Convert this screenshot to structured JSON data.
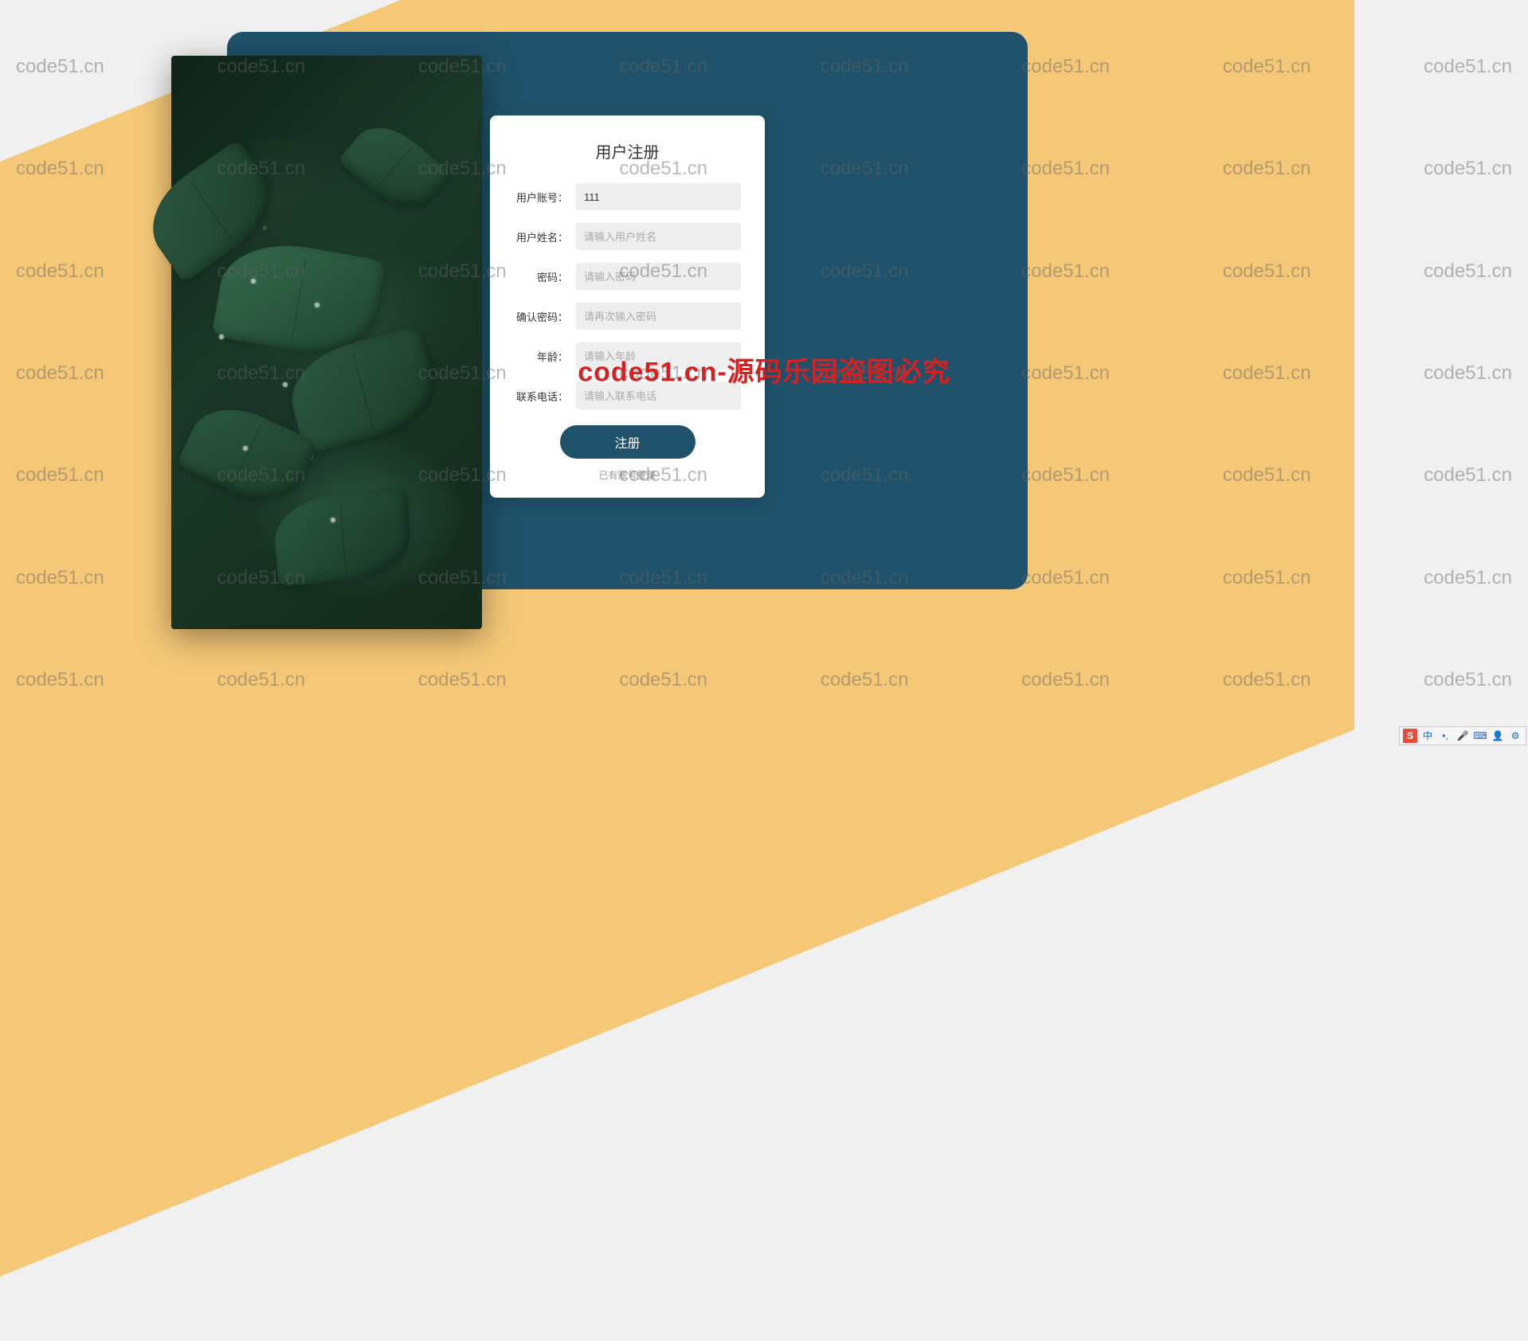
{
  "watermark_text": "code51.cn",
  "center_watermark": "code51.cn-源码乐园盗图必究",
  "form": {
    "title": "用户注册",
    "fields": {
      "account": {
        "label": "用户账号：",
        "value": "111",
        "placeholder": ""
      },
      "name": {
        "label": "用户姓名：",
        "value": "",
        "placeholder": "请输入用户姓名"
      },
      "password": {
        "label": "密码：",
        "value": "",
        "placeholder": "请输入密码"
      },
      "confirm": {
        "label": "确认密码：",
        "value": "",
        "placeholder": "请再次输入密码"
      },
      "age": {
        "label": "年龄：",
        "value": "",
        "placeholder": "请输入年龄"
      },
      "phone": {
        "label": "联系电话：",
        "value": "",
        "placeholder": "请输入联系电话"
      }
    },
    "submit_label": "注册",
    "login_link": "已有账号登录"
  },
  "ime": {
    "logo": "S",
    "items": [
      "中",
      "•,",
      "🎤",
      "⌨",
      "👤",
      "⚙"
    ]
  }
}
